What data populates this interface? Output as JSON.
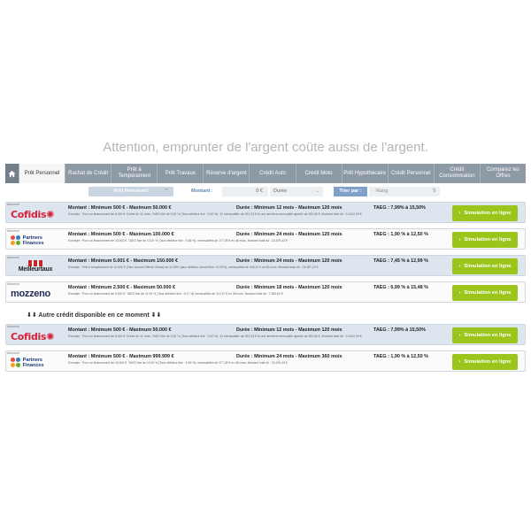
{
  "headline": "Attention, emprunter de l'argent coûte aussi de l'argent.",
  "tabs": [
    {
      "label": "Prêt Personnel",
      "active": true
    },
    {
      "label": "Rachat de Crédit",
      "active": false
    },
    {
      "label": "Prêt à Tempérament",
      "active": false
    },
    {
      "label": "Prêt Travaux",
      "active": false
    },
    {
      "label": "Réserve d'argent",
      "active": false
    },
    {
      "label": "Crédit Auto",
      "active": false
    },
    {
      "label": "Crédit Moto",
      "active": false
    },
    {
      "label": "Prêt Hypothécaire",
      "active": false
    },
    {
      "label": "Crédit Personnel",
      "active": false
    },
    {
      "label": "Crédit Consommation",
      "active": false
    },
    {
      "label": "Comparez les Offres",
      "active": false
    }
  ],
  "filters": {
    "type_value": "Prêt Personnel",
    "montant_label": "Montant :",
    "montant_value": "0 €",
    "duree_placeholder": "Durée",
    "sort_label": "Trier par :",
    "sort_value": "Rang"
  },
  "annonce_label": "Annonce",
  "sim_button_label": "Simulation en ligne",
  "offers": [
    {
      "brand": "Cofidis",
      "amount": "Montant : Minimum 500 € - Maximum 50.000 €",
      "duration": "Durée : Minimum 12 mois - Maximum 120 mois",
      "taeg": "TAEG : 7,99% à 15,50%",
      "example": "Exemple : Pour un financement de 8.000 €. Durée de 42 mois. TAEG fixe de 9,45 % (Taux débiteur fixe : 9,40 %). 41 mensualités de 251,03 € et une dernière mensualité ajustée de 250,86 €. Montant total dû : 10.542,09 €"
    },
    {
      "brand": "Partners Finances",
      "amount": "Montant : Minimum 500 € - Maximum 100.000 €",
      "duration": "Durée : Minimum 24 mois - Maximum 120 mois",
      "taeg": "TAEG : 1,90 % à 12,50 %",
      "example": "Exemple : Pour un financement de 15.000 €. TAEG fixe de 10,00 % (Taux débiteur fixe : 9,56 %). mensualités de 377,28 € en 48 mois. Montant total dû : 18.109,43 €"
    },
    {
      "brand": "Meilleurtaux",
      "amount": "Montant : Minimum 5.001 € - Maximum 150.000 €",
      "duration": "Durée : Minimum 24 mois - Maximum 120 mois",
      "taeg": "TAEG : 7,45 % à 12,99 %",
      "example": "Exemple : Prêt à tempérament de 10.000 € (Taux Annuel Effectif Global) de 12,69% (taux débiteur annuel fixe: 12,00%), mensualités de 408,12 € en 60 mois. Montant total dû : 24.487,20 €"
    },
    {
      "brand": "mozzeno",
      "amount": "Montant : Minimum 2.500 € - Maximum 50.000 €",
      "duration": "Durée : Minimum 18 mois - Maximum 120 mois",
      "taeg": "TAEG : 6,99 % à 15,48 %",
      "example": "Exemple : Pour un financement de 6.500 €. TAEG fixe de 11,49 % (Taux débiteur fixe : 9,17 %) mensualités de 212,57 € en 36 mois. Montant total dû : 7.652,52 €"
    }
  ],
  "other_heading": "⬇⬇ Autre crédit disponible en ce moment ⬇⬇",
  "other_offers": [
    {
      "brand": "Cofidis",
      "amount": "Montant : Minimum 500 € - Maximum 50.000 €",
      "duration": "Durée : Minimum 12 mois - Maximum 120 mois",
      "taeg": "TAEG : 7,99% à 15,50%",
      "example": "Exemple : Pour un financement de 8.000 €. Durée de 42 mois. TAEG fixe de 9,45 % (Taux débiteur fixe : 9,40 %). 41 mensualités de 251,03 € et une dernière mensualité ajustée de 250,86 €. Montant total dû : 10.542,09 €"
    },
    {
      "brand": "Partners Finances",
      "amount": "Montant : Minimum 500 € - Maximum 999.999 €",
      "duration": "Durée : Minimum 24 mois - Maximum 360 mois",
      "taeg": "TAEG : 1,90 % à 12,50 %",
      "example": "Exemple : Pour un financement de 15.000 €. TAEG fixe de 10,00 % (Taux débiteur fixe : 9,56 %). mensualités de 377,28 € en 48 mois. Montant total dû : 18.109,43 €"
    }
  ]
}
